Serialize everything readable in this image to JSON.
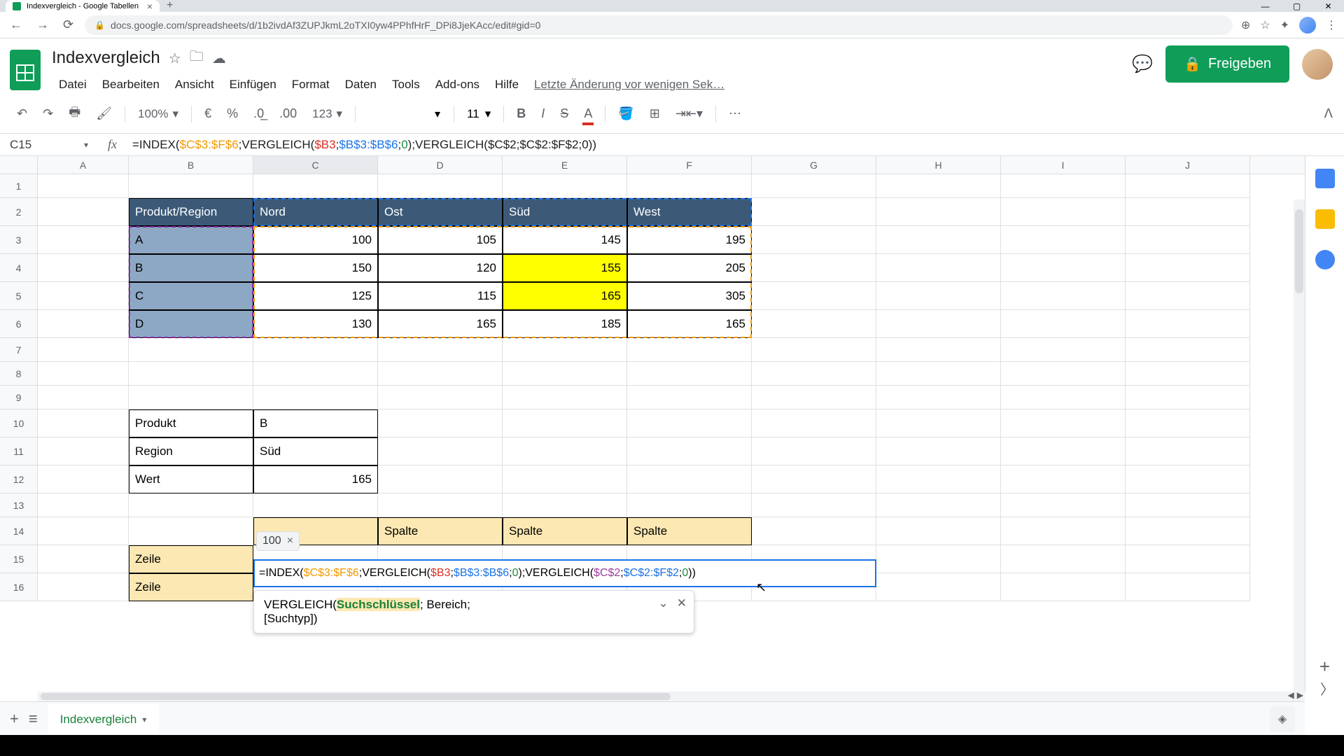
{
  "browser": {
    "tab_title": "Indexvergleich - Google Tabellen",
    "url": "docs.google.com/spreadsheets/d/1b2ivdAf3ZUPJkmL2oTXI0yw4PPhfHrF_DPi8JjeKAcc/edit#gid=0"
  },
  "header": {
    "doc_title": "Indexvergleich",
    "share_label": "Freigeben",
    "last_edit": "Letzte Änderung vor wenigen Sek…"
  },
  "menu": [
    "Datei",
    "Bearbeiten",
    "Ansicht",
    "Einfügen",
    "Format",
    "Daten",
    "Tools",
    "Add-ons",
    "Hilfe"
  ],
  "toolbar": {
    "zoom": "100%",
    "currency": "€",
    "percent": "%",
    "dec_dec": ".0",
    "inc_dec": ".00",
    "format_num": "123",
    "font_size": "11"
  },
  "name_box": "C15",
  "formula_bar": {
    "prefix": "=INDEX(",
    "rng1": "$C$3:$F$6",
    "sep1": ";",
    "fn2": "VERGLEICH(",
    "rng2": "$B3",
    "sep2": ";",
    "rng3": "$B$3:$B$6",
    "sep3": ";",
    "num1": "0",
    "close1": ");",
    "fn3": "VERGLEICH(",
    "rng4": "$C$2",
    "sep4": ";",
    "rng5": "$C$2:$F$2",
    "sep5": ";",
    "num2": "0",
    "close2": "))"
  },
  "columns": [
    "A",
    "B",
    "C",
    "D",
    "E",
    "F",
    "G",
    "H",
    "I",
    "J"
  ],
  "rows": [
    "1",
    "2",
    "3",
    "4",
    "5",
    "6",
    "7",
    "8",
    "9",
    "10",
    "11",
    "12",
    "13",
    "14",
    "15",
    "16"
  ],
  "table1": {
    "header": [
      "Produkt/Region",
      "Nord",
      "Ost",
      "Süd",
      "West"
    ],
    "rows": [
      {
        "p": "A",
        "v": [
          "100",
          "105",
          "145",
          "195"
        ]
      },
      {
        "p": "B",
        "v": [
          "150",
          "120",
          "155",
          "205"
        ]
      },
      {
        "p": "C",
        "v": [
          "125",
          "115",
          "165",
          "305"
        ]
      },
      {
        "p": "D",
        "v": [
          "130",
          "165",
          "185",
          "165"
        ]
      }
    ]
  },
  "lookup": {
    "produkt_lbl": "Produkt",
    "produkt_val": "B",
    "region_lbl": "Region",
    "region_val": "Süd",
    "wert_lbl": "Wert",
    "wert_val": "165"
  },
  "table2": {
    "spalte": "Spalte",
    "zeile": "Zeile"
  },
  "result_tip": "100",
  "editing_formula": {
    "prefix": "=INDEX(",
    "rng1": "$C$3:$F$6",
    "s1": ";VERGLEICH(",
    "rng2": "$B3",
    "s2": ";",
    "rng3": "$B$3:$B$6",
    "s3": ";",
    "n1": "0",
    "s4": ");VERGLEICH(",
    "rng4": "$C$2",
    "s5": ";",
    "rng5": "$C$2:$F$2",
    "s6": ";",
    "n2": "0",
    "s7": "))"
  },
  "help": {
    "fn": "VERGLEICH(",
    "arg1": "Suchschlüssel",
    "rest1": "; Bereich;",
    "rest2": "[Suchtyp])"
  },
  "sheet_tab": "Indexvergleich"
}
